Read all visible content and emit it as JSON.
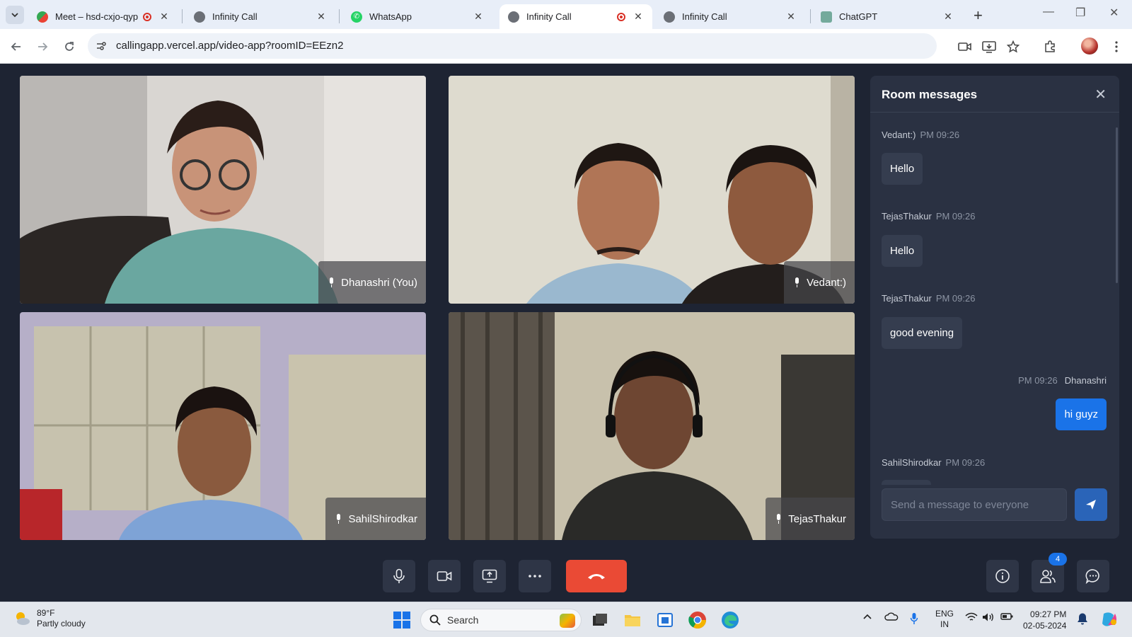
{
  "browser": {
    "tabs": [
      {
        "title": "Meet – hsd-cxjo-qyp",
        "recording": true
      },
      {
        "title": "Infinity Call",
        "recording": false
      },
      {
        "title": "WhatsApp",
        "recording": false
      },
      {
        "title": "Infinity Call",
        "recording": true
      },
      {
        "title": "Infinity Call",
        "recording": false
      },
      {
        "title": "ChatGPT",
        "recording": false
      }
    ],
    "active_tab_index": 3,
    "url": "callingapp.vercel.app/video-app?roomID=EEzn2"
  },
  "participants": [
    {
      "name": "Dhanashri (You)"
    },
    {
      "name": "Vedant:)"
    },
    {
      "name": "SahilShirodkar"
    },
    {
      "name": "TejasThakur"
    }
  ],
  "chat": {
    "title": "Room messages",
    "messages": [
      {
        "sender": "Vedant:)",
        "time": "PM 09:26",
        "text": "Hello",
        "mine": false
      },
      {
        "sender": "TejasThakur",
        "time": "PM 09:26",
        "text": "Hello",
        "mine": false
      },
      {
        "sender": "TejasThakur",
        "time": "PM 09:26",
        "text": "good evening",
        "mine": false
      },
      {
        "sender": "Dhanashri",
        "time": "PM 09:26",
        "text": "hi guyz",
        "mine": true
      },
      {
        "sender": "SahilShirodkar",
        "time": "PM 09:26",
        "text": "",
        "mine": false
      }
    ],
    "input_placeholder": "Send a message to everyone"
  },
  "controls": {
    "participants_badge": "4"
  },
  "taskbar": {
    "weather_temp": "89°F",
    "weather_desc": "Partly cloudy",
    "search_label": "Search",
    "lang_line1": "ENG",
    "lang_line2": "IN",
    "time": "09:27 PM",
    "date": "02-05-2024"
  },
  "colors": {
    "app_bg": "#1e2433",
    "panel_bg": "#2a3142",
    "accent_blue": "#1a73e8",
    "end_call_red": "#ea4a35"
  }
}
